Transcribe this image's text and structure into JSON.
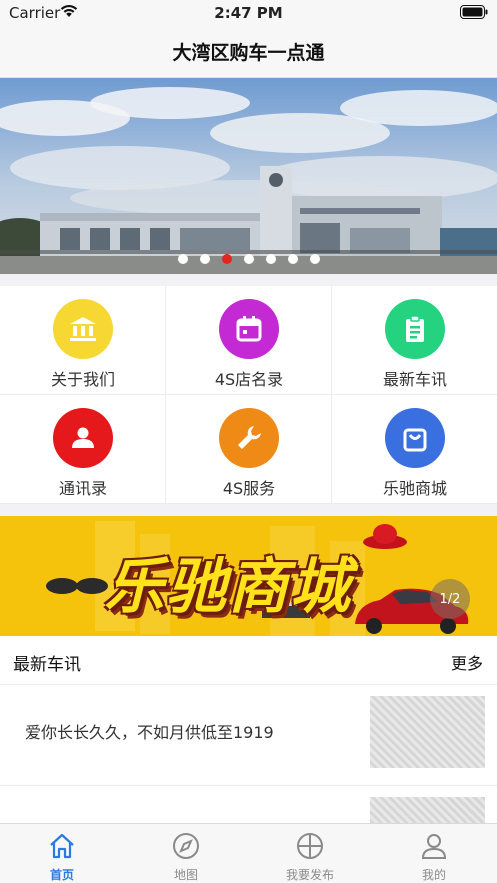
{
  "status_bar": {
    "carrier": "Carrier",
    "time": "2:47 PM"
  },
  "nav": {
    "title": "大湾区购车一点通"
  },
  "banner": {
    "page_count": 7,
    "active_index": 2
  },
  "grid": {
    "items": [
      {
        "label": "关于我们",
        "icon": "bank-icon",
        "color": "#f7d731"
      },
      {
        "label": "4S店名录",
        "icon": "calendar-icon",
        "color": "#c32ad3"
      },
      {
        "label": "最新车讯",
        "icon": "clipboard-icon",
        "color": "#24d27f"
      },
      {
        "label": "通讯录",
        "icon": "contact-icon",
        "color": "#e5191b"
      },
      {
        "label": "4S服务",
        "icon": "wrench-icon",
        "color": "#f08a17"
      },
      {
        "label": "乐驰商城",
        "icon": "shopping-bag-icon",
        "color": "#3a6fe0"
      }
    ]
  },
  "promo": {
    "title": "乐驰商城",
    "page_indicator": "1/2"
  },
  "news": {
    "title": "最新车讯",
    "more": "更多",
    "items": [
      {
        "text": "爱你长长久久，不如月供低至1919"
      },
      {
        "text": ""
      }
    ]
  },
  "tabs": [
    {
      "label": "首页",
      "icon": "home-icon",
      "active": true
    },
    {
      "label": "地图",
      "icon": "compass-icon",
      "active": false
    },
    {
      "label": "我要发布",
      "icon": "crosshair-icon",
      "active": false
    },
    {
      "label": "我的",
      "icon": "user-icon",
      "active": false
    }
  ],
  "colors": {
    "accent": "#2a7ae2",
    "indicator_active": "#e5241f"
  }
}
